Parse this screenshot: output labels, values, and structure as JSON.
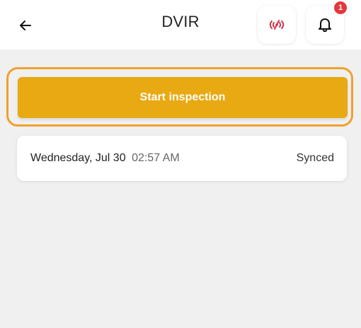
{
  "header": {
    "title": "DVIR",
    "back_icon": "arrow-left-icon",
    "signal_icon": "signal-broadcast-icon",
    "signal_color": "#d1344b",
    "bell_icon": "bell-icon",
    "notification_count": "1"
  },
  "cta": {
    "label": "Start inspection",
    "button_color": "#e8a912",
    "outline_color": "#f0a12b"
  },
  "inspection": {
    "date": "Wednesday, Jul 30",
    "time": "02:57 AM",
    "status": "Synced"
  }
}
